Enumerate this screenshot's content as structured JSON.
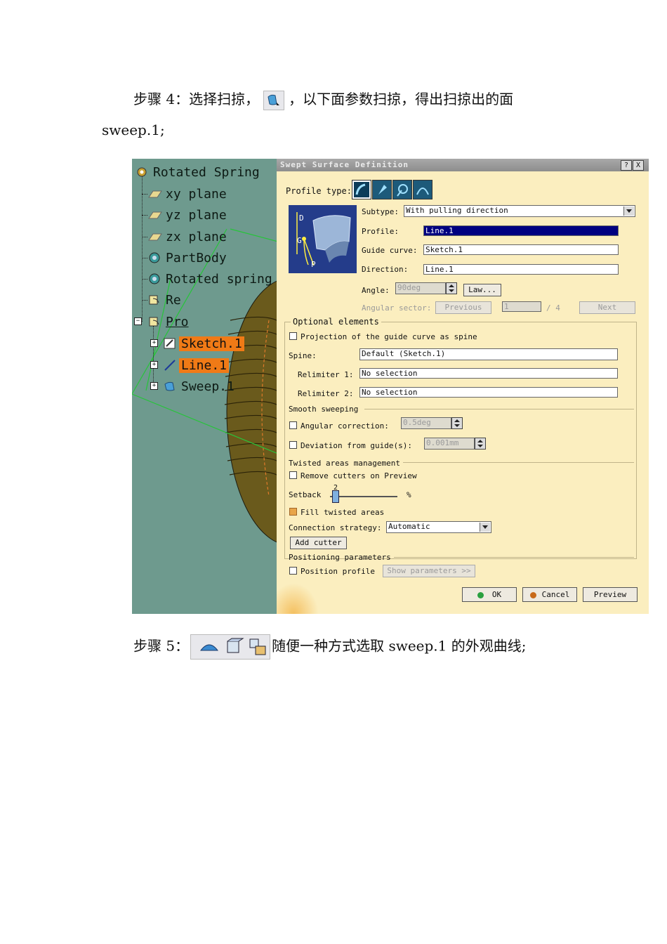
{
  "step4": {
    "prefix": "步骤 4：选择扫掠，",
    "suffix": "，以下面参数扫掠，得出扫掠出的面",
    "line2": "sweep.1;"
  },
  "step5": {
    "prefix": "步骤 5：",
    "suffix": "随便一种方式选取 sweep.1 的外观曲线;"
  },
  "tree": {
    "root": "Rotated Spring",
    "items": [
      "xy plane",
      "yz plane",
      "zx plane",
      "PartBody",
      "Rotated spring",
      "Re",
      "Pro"
    ],
    "children": [
      "Sketch.1",
      "Line.1",
      "Sweep.1"
    ]
  },
  "dialog": {
    "title": "Swept Surface Definition",
    "help": "?",
    "close": "X",
    "profile_type_label": "Profile type:",
    "subtype_label": "Subtype:",
    "subtype_value": "With pulling direction",
    "profile_label": "Profile:",
    "profile_value": "Line.1",
    "guide_label": "Guide curve:",
    "guide_value": "Sketch.1",
    "direction_label": "Direction:",
    "direction_value": "Line.1",
    "angle_label": "Angle:",
    "angle_value": "90deg",
    "law_button": "Law...",
    "angular_sector_label": "Angular sector:",
    "previous_button": "Previous",
    "sector_value": "1",
    "sector_total": "/ 4",
    "next_button": "Next",
    "optional_title": "Optional elements",
    "projection_label": "Projection of the guide curve as spine",
    "spine_label": "Spine:",
    "spine_value": "Default (Sketch.1)",
    "relimiter1_label": "Relimiter 1:",
    "relimiter1_value": "No selection",
    "relimiter2_label": "Relimiter 2:",
    "relimiter2_value": "No selection",
    "smooth_title": "Smooth sweeping",
    "angular_correction_label": "Angular correction:",
    "angular_correction_value": "0.5deg",
    "deviation_label": "Deviation from guide(s):",
    "deviation_value": "0.001mm",
    "twisted_title": "Twisted areas management",
    "remove_cutters_label": "Remove cutters on Preview",
    "setback_label": "Setback",
    "setback_value": "2",
    "setback_unit": "%",
    "fill_label": "Fill twisted areas",
    "connection_label": "Connection strategy:",
    "connection_value": "Automatic",
    "add_cutter_button": "Add cutter",
    "positioning_title": "Positioning parameters",
    "position_profile_label": "Position profile",
    "show_parameters_button": "Show parameters >>",
    "ok_button": "OK",
    "cancel_button": "Cancel",
    "preview_button": "Preview",
    "sketch_letters": [
      "D",
      "G",
      "P"
    ]
  },
  "colors": {
    "viewport": "#6e9a8e",
    "dialog_bg": "#fbeebf",
    "selection": "#f07a16",
    "active_field": "#000080"
  }
}
